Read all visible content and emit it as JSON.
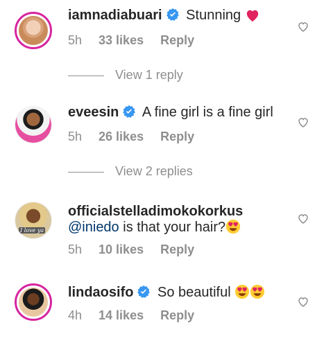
{
  "comments": [
    {
      "username": "iamnadiabuari",
      "verified": true,
      "text": "Stunning",
      "emoji": "heart",
      "time": "5h",
      "likes": "33 likes",
      "reply": "Reply",
      "view_replies": "View 1 reply"
    },
    {
      "username": "eveesin",
      "verified": true,
      "text": "A fine girl is a fine girl",
      "time": "5h",
      "likes": "26 likes",
      "reply": "Reply",
      "view_replies": "View 2 replies"
    },
    {
      "username": "officialstelladimokokorkus",
      "verified": false,
      "mention": "@iniedo",
      "text": "is that your hair?",
      "emoji": "heart-eyes",
      "avatar_caption": "I love ya",
      "time": "5h",
      "likes": "10 likes",
      "reply": "Reply"
    },
    {
      "username": "lindaosifo",
      "verified": true,
      "text": "So beautiful",
      "emoji": "heart-eyes x2",
      "time": "4h",
      "likes": "14 likes",
      "reply": "Reply"
    }
  ],
  "colors": {
    "text": "#262626",
    "secondary": "#8e8e8e",
    "verified": "#3897f0",
    "mention": "#00376b",
    "story_ring": "#d6249f"
  }
}
